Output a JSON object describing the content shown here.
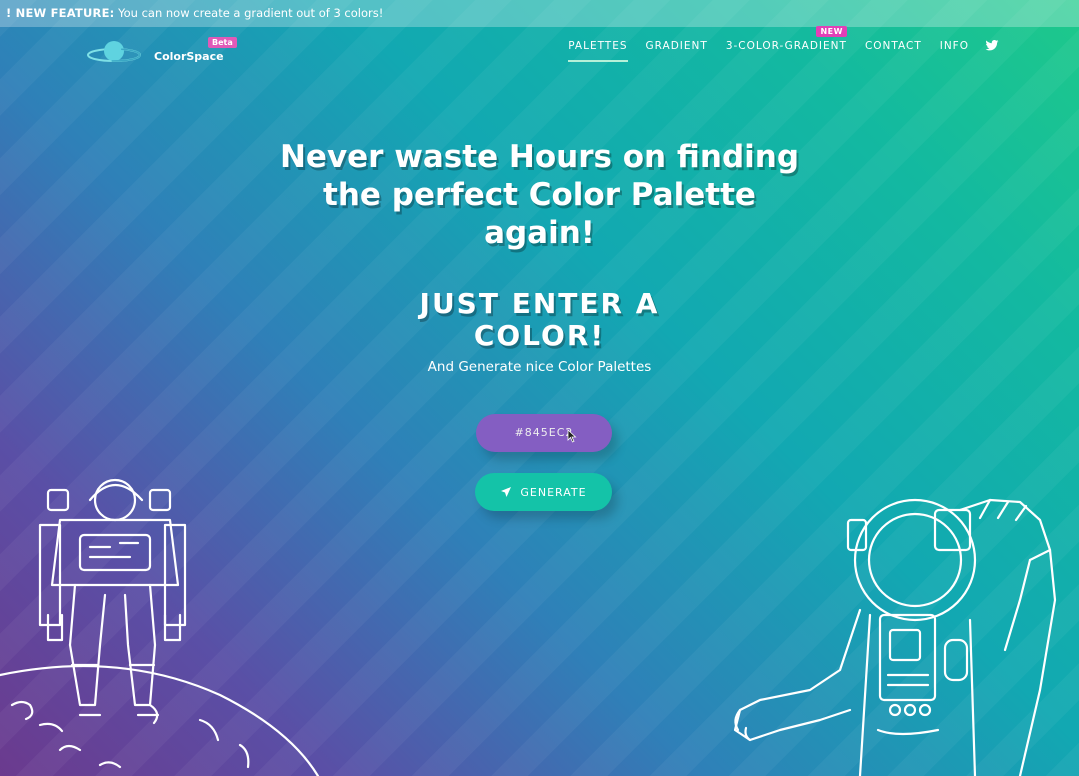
{
  "banner": {
    "label": "! NEW FEATURE:",
    "text": "You can now create a gradient out of 3 colors!"
  },
  "brand": {
    "name": "ColorSpace",
    "badge": "Beta",
    "logo_icon": "planet-icon"
  },
  "nav": {
    "items": [
      {
        "label": "PALETTES",
        "active": true
      },
      {
        "label": "GRADIENT",
        "active": false
      },
      {
        "label": "3-COLOR-GRADIENT",
        "active": false,
        "badge": "NEW"
      },
      {
        "label": "CONTACT",
        "active": false
      },
      {
        "label": "INFO",
        "active": false
      }
    ],
    "twitter_icon": "twitter-icon"
  },
  "hero": {
    "line1": "Never waste Hours on finding",
    "line2": "the perfect Color Palette",
    "line3": "again!",
    "sub1": "JUST ENTER A",
    "sub2": "COLOR!",
    "tagline": "And Generate nice Color Palettes"
  },
  "form": {
    "color_value": "#845EC2",
    "generate_label": "GENERATE",
    "generate_icon": "rocket-icon"
  },
  "colors": {
    "accent": "#845ec2",
    "button": "#14c3a8",
    "badge": "#e23fb7"
  }
}
